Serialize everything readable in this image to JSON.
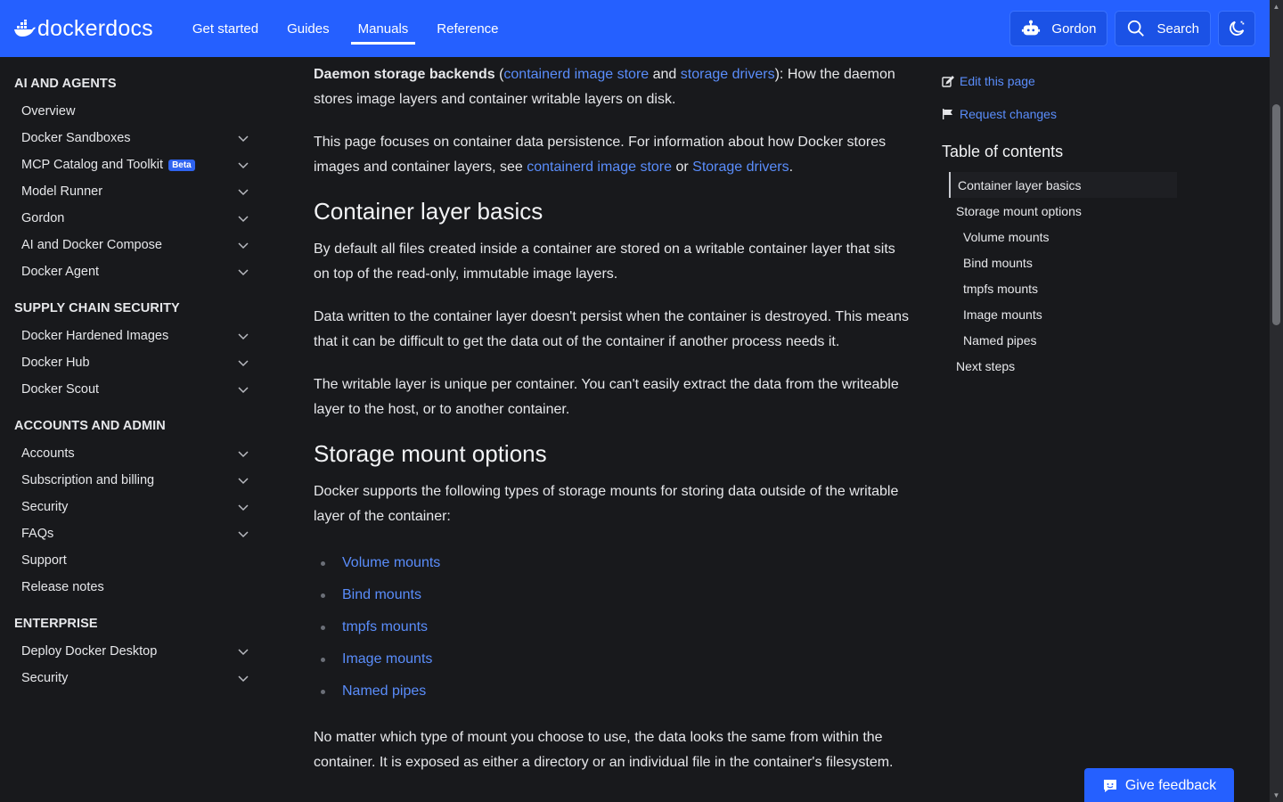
{
  "header": {
    "logo_text": "dockerdocs",
    "nav": [
      "Get started",
      "Guides",
      "Manuals",
      "Reference"
    ],
    "active_nav": "Manuals",
    "gordon_label": "Gordon",
    "search_label": "Search"
  },
  "sidebar": {
    "sections": [
      {
        "title": "AI AND AGENTS",
        "items": [
          {
            "label": "Overview",
            "expandable": false
          },
          {
            "label": "Docker Sandboxes",
            "expandable": true
          },
          {
            "label": "MCP Catalog and Toolkit",
            "badge": "Beta",
            "expandable": true
          },
          {
            "label": "Model Runner",
            "expandable": true
          },
          {
            "label": "Gordon",
            "expandable": true
          },
          {
            "label": "AI and Docker Compose",
            "expandable": true
          },
          {
            "label": "Docker Agent",
            "expandable": true
          }
        ]
      },
      {
        "title": "SUPPLY CHAIN SECURITY",
        "items": [
          {
            "label": "Docker Hardened Images",
            "expandable": true
          },
          {
            "label": "Docker Hub",
            "expandable": true
          },
          {
            "label": "Docker Scout",
            "expandable": true
          }
        ]
      },
      {
        "title": "ACCOUNTS AND ADMIN",
        "items": [
          {
            "label": "Accounts",
            "expandable": true
          },
          {
            "label": "Subscription and billing",
            "expandable": true
          },
          {
            "label": "Security",
            "expandable": true
          },
          {
            "label": "FAQs",
            "expandable": true
          },
          {
            "label": "Support",
            "expandable": false
          },
          {
            "label": "Release notes",
            "expandable": false
          }
        ]
      },
      {
        "title": "ENTERPRISE",
        "items": [
          {
            "label": "Deploy Docker Desktop",
            "expandable": true
          },
          {
            "label": "Security",
            "expandable": true
          }
        ]
      }
    ]
  },
  "main": {
    "p1": {
      "bold": "Daemon storage backends",
      "t1": " (",
      "link1": "containerd image store",
      "t2": " and ",
      "link2": "storage drivers",
      "t3": "): How the daemon stores image layers and container writable layers on disk."
    },
    "p2": {
      "t1": "This page focuses on container data persistence. For information about how Docker stores images and container layers, see ",
      "link1": "containerd image store",
      "t2": " or ",
      "link2": "Storage drivers",
      "t3": "."
    },
    "h_layer": "Container layer basics",
    "p3": "By default all files created inside a container are stored on a writable container layer that sits on top of the read-only, immutable image layers.",
    "p4": "Data written to the container layer doesn't persist when the container is destroyed. This means that it can be difficult to get the data out of the container if another process needs it.",
    "p5": "The writable layer is unique per container. You can't easily extract the data from the writeable layer to the host, or to another container.",
    "h_mount": "Storage mount options",
    "p6": "Docker supports the following types of storage mounts for storing data outside of the writable layer of the container:",
    "mount_links": [
      "Volume mounts",
      "Bind mounts",
      "tmpfs mounts",
      "Image mounts",
      "Named pipes"
    ],
    "p7": "No matter which type of mount you choose to use, the data looks the same from within the container. It is exposed as either a directory or an individual file in the container's filesystem."
  },
  "rail": {
    "edit": "Edit this page",
    "request": "Request changes",
    "toc_title": "Table of contents",
    "toc": [
      {
        "label": "Container layer basics",
        "level": 1,
        "active": true
      },
      {
        "label": "Storage mount options",
        "level": 1
      },
      {
        "label": "Volume mounts",
        "level": 2
      },
      {
        "label": "Bind mounts",
        "level": 2
      },
      {
        "label": "tmpfs mounts",
        "level": 2
      },
      {
        "label": "Image mounts",
        "level": 2
      },
      {
        "label": "Named pipes",
        "level": 2
      },
      {
        "label": "Next steps",
        "level": 1
      }
    ]
  },
  "feedback_label": "Give feedback",
  "colors": {
    "brand": "#2560ff",
    "link": "#5a8dfb",
    "background": "#18191c"
  }
}
